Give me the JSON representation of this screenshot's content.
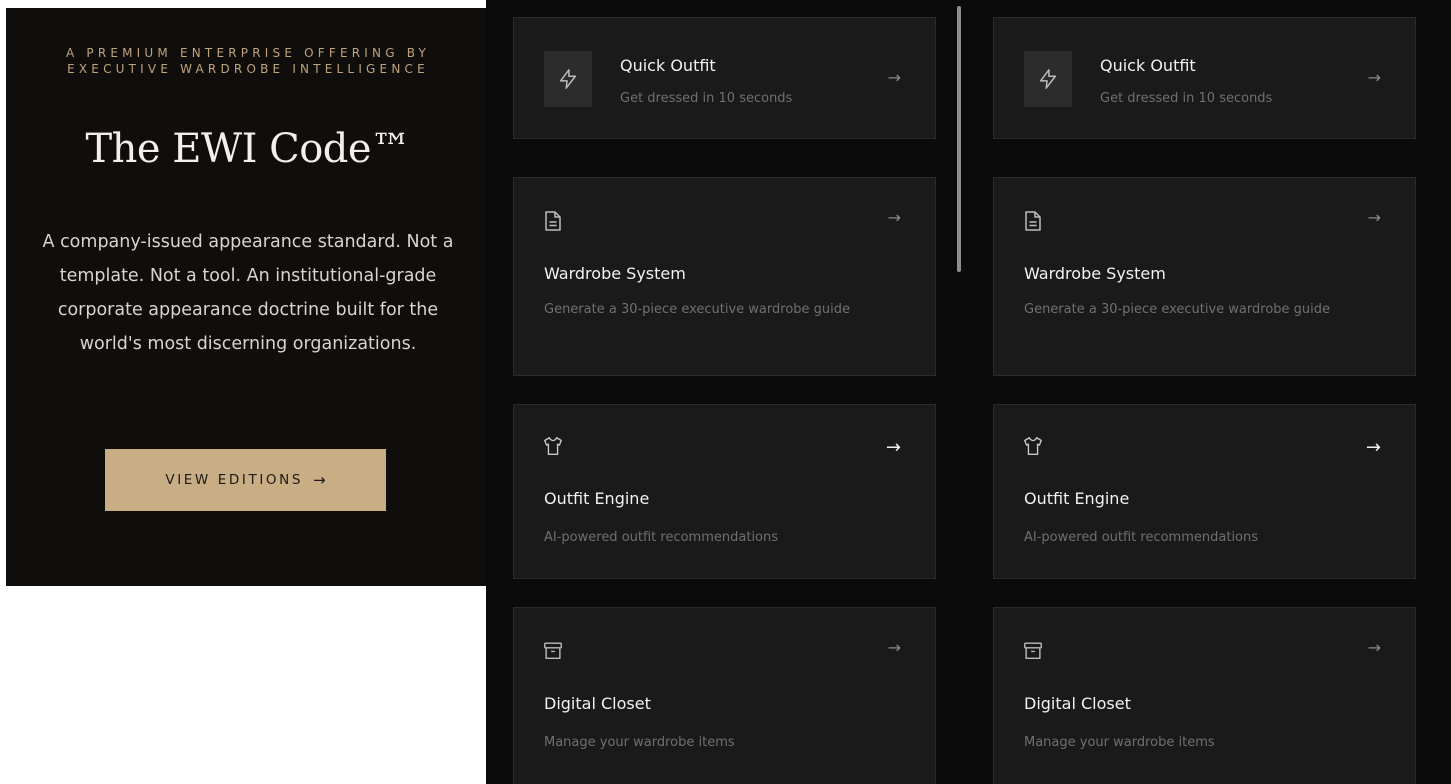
{
  "hero": {
    "eyebrow_line1": "A PREMIUM ENTERPRISE OFFERING BY",
    "eyebrow_line2": "EXECUTIVE WARDROBE INTELLIGENCE",
    "title": "The EWI Code™",
    "description": "A company-issued appearance standard. Not a template. Not a tool. An institutional-grade corporate appearance doctrine built for the world's most discerning organizations.",
    "cta_label": "VIEW EDITIONS",
    "cta_arrow": "→",
    "colors": {
      "background": "#0f0e0d",
      "eyebrow": "#bfa37a",
      "cta": "#c9ae85"
    }
  },
  "columns": [
    {
      "cards": {
        "quick_outfit": {
          "title": "Quick Outfit",
          "subtitle": "Get dressed in 10 seconds",
          "icon": "lightning-icon",
          "arrow": "→"
        },
        "wardrobe_system": {
          "title": "Wardrobe System",
          "subtitle": "Generate a 30-piece executive wardrobe guide",
          "icon": "document-icon",
          "arrow": "→"
        },
        "outfit_engine": {
          "title": "Outfit Engine",
          "subtitle": "AI-powered outfit recommendations",
          "icon": "shirt-icon",
          "arrow": "→"
        },
        "digital_closet": {
          "title": "Digital Closet",
          "subtitle": "Manage your wardrobe items",
          "icon": "archive-box-icon",
          "arrow": "→"
        }
      }
    },
    {
      "cards": {
        "quick_outfit": {
          "title": "Quick Outfit",
          "subtitle": "Get dressed in 10 seconds",
          "icon": "lightning-icon",
          "arrow": "→"
        },
        "wardrobe_system": {
          "title": "Wardrobe System",
          "subtitle": "Generate a 30-piece executive wardrobe guide",
          "icon": "document-icon",
          "arrow": "→"
        },
        "outfit_engine": {
          "title": "Outfit Engine",
          "subtitle": "AI-powered outfit recommendations",
          "icon": "shirt-icon",
          "arrow": "→"
        },
        "digital_closet": {
          "title": "Digital Closet",
          "subtitle": "Manage your wardrobe items",
          "icon": "archive-box-icon",
          "arrow": "→"
        }
      }
    }
  ]
}
